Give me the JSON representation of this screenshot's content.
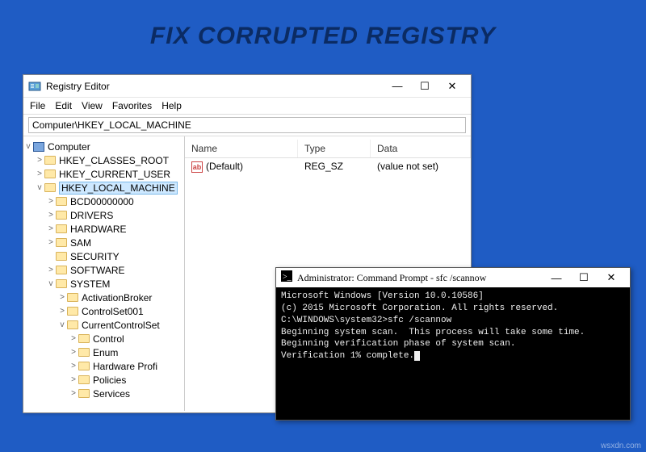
{
  "banner": "FIX CORRUPTED REGISTRY",
  "watermark": "wsxdn.com",
  "regedit": {
    "title": "Registry Editor",
    "menu": [
      "File",
      "Edit",
      "View",
      "Favorites",
      "Help"
    ],
    "address": "Computer\\HKEY_LOCAL_MACHINE",
    "columns": {
      "name": "Name",
      "type": "Type",
      "data": "Data"
    },
    "row": {
      "name": "(Default)",
      "type": "REG_SZ",
      "data": "(value not set)"
    },
    "winctrl": {
      "min": "—",
      "max": "☐",
      "close": "✕"
    },
    "tree": [
      {
        "depth": 1,
        "tw": "v",
        "icon": "pc",
        "label": "Computer"
      },
      {
        "depth": 2,
        "tw": ">",
        "icon": "fld",
        "label": "HKEY_CLASSES_ROOT"
      },
      {
        "depth": 2,
        "tw": ">",
        "icon": "fld",
        "label": "HKEY_CURRENT_USER"
      },
      {
        "depth": 2,
        "tw": "v",
        "icon": "fld",
        "label": "HKEY_LOCAL_MACHINE",
        "sel": true
      },
      {
        "depth": 3,
        "tw": ">",
        "icon": "fld",
        "label": "BCD00000000"
      },
      {
        "depth": 3,
        "tw": ">",
        "icon": "fld",
        "label": "DRIVERS"
      },
      {
        "depth": 3,
        "tw": ">",
        "icon": "fld",
        "label": "HARDWARE"
      },
      {
        "depth": 3,
        "tw": ">",
        "icon": "fld",
        "label": "SAM"
      },
      {
        "depth": 3,
        "tw": "",
        "icon": "fld",
        "label": "SECURITY"
      },
      {
        "depth": 3,
        "tw": ">",
        "icon": "fld",
        "label": "SOFTWARE"
      },
      {
        "depth": 3,
        "tw": "v",
        "icon": "fld",
        "label": "SYSTEM"
      },
      {
        "depth": 4,
        "tw": ">",
        "icon": "fld",
        "label": "ActivationBroker"
      },
      {
        "depth": 4,
        "tw": ">",
        "icon": "fld",
        "label": "ControlSet001"
      },
      {
        "depth": 4,
        "tw": "v",
        "icon": "fld",
        "label": "CurrentControlSet"
      },
      {
        "depth": 5,
        "tw": ">",
        "icon": "fld",
        "label": "Control"
      },
      {
        "depth": 5,
        "tw": ">",
        "icon": "fld",
        "label": "Enum"
      },
      {
        "depth": 5,
        "tw": ">",
        "icon": "fld",
        "label": "Hardware Profi"
      },
      {
        "depth": 5,
        "tw": ">",
        "icon": "fld",
        "label": "Policies"
      },
      {
        "depth": 5,
        "tw": ">",
        "icon": "fld",
        "label": "Services"
      }
    ]
  },
  "cmd": {
    "title": "Administrator: Command Prompt - sfc  /scannow",
    "lines": [
      "Microsoft Windows [Version 10.0.10586]",
      "(c) 2015 Microsoft Corporation. All rights reserved.",
      "",
      "C:\\WINDOWS\\system32>sfc /scannow",
      "",
      "Beginning system scan.  This process will take some time.",
      "",
      "Beginning verification phase of system scan.",
      "Verification 1% complete."
    ],
    "winctrl": {
      "min": "—",
      "max": "☐",
      "close": "✕"
    }
  }
}
